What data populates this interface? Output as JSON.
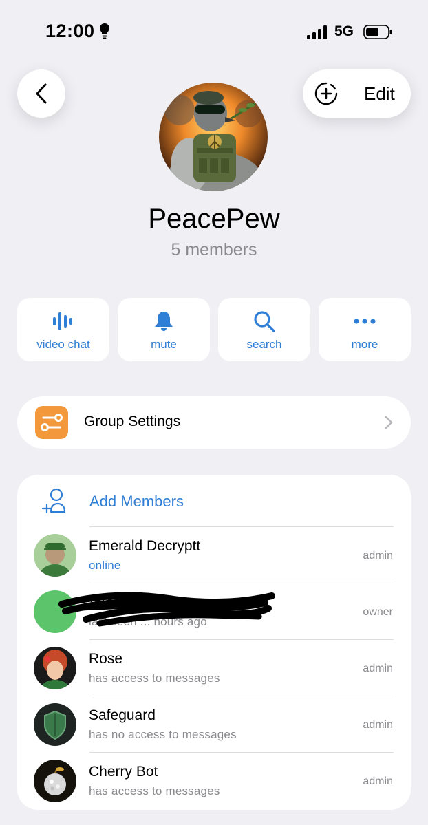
{
  "status_bar": {
    "time": "12:00",
    "time_icon": "lightbulb-icon",
    "network": "5G",
    "signal_icon": "cellular-signal-icon",
    "battery_icon": "battery-icon"
  },
  "header": {
    "back_icon": "chevron-left-icon",
    "add_photo_icon": "add-photo-icon",
    "edit_label": "Edit"
  },
  "group": {
    "name": "PeacePew",
    "members_count": "5 members"
  },
  "actions": [
    {
      "label": "video chat",
      "icon": "voice-chat-icon"
    },
    {
      "label": "mute",
      "icon": "bell-icon"
    },
    {
      "label": "search",
      "icon": "search-icon"
    },
    {
      "label": "more",
      "icon": "more-icon"
    }
  ],
  "settings": {
    "label": "Group Settings",
    "icon": "settings-sliders-icon",
    "icon_color": "#f3993b"
  },
  "members_section": {
    "add_label": "Add Members",
    "add_icon": "add-member-icon",
    "items": [
      {
        "name": "Emerald Decryptt",
        "status": "online",
        "role": "admin",
        "avatar_color": "#a8cf9a"
      },
      {
        "name": "Vance W...oll",
        "status": "last seen ... hours ago",
        "role": "owner",
        "avatar_color": "#5cc46a"
      },
      {
        "name": "Rose",
        "status": "has access to messages",
        "role": "admin",
        "avatar_color": "#c44a2a"
      },
      {
        "name": "Safeguard",
        "status": "has no access to messages",
        "role": "admin",
        "avatar_color": "#1e2422"
      },
      {
        "name": "Cherry Bot",
        "status": "has access to messages",
        "role": "admin",
        "avatar_color": "#15120c"
      }
    ]
  },
  "colors": {
    "accent": "#2f7fd6",
    "background": "#efeff4",
    "secondary_text": "#8a8a8e"
  }
}
